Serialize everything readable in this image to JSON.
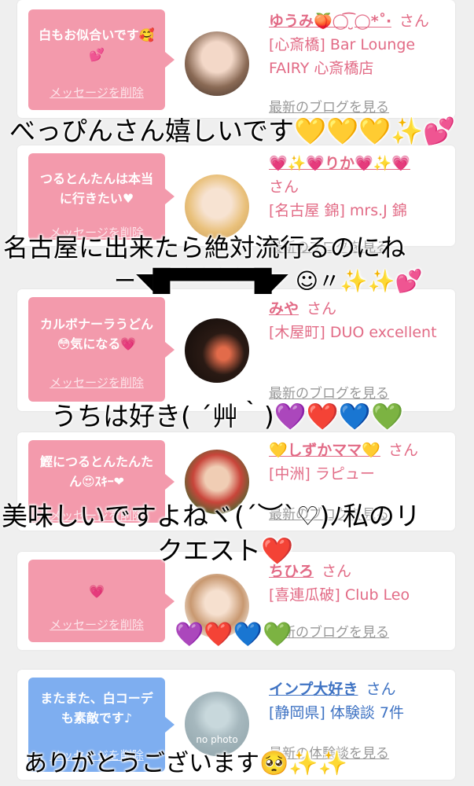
{
  "cards": [
    {
      "message": "白もお似合いです🥰💕",
      "delete_label": "メッセージを削除",
      "user": "ゆうみ🍑◯͡ ̮◯*˚‧",
      "san": "さん",
      "shop_area": "[心斎橋] Bar Lounge FAIRY 心斎橋店",
      "blog_link": "最新のブログを見る"
    },
    {
      "message": "つるとんたんは本当に行きたい♥",
      "delete_label": "メッセージを削除",
      "user": "💗✨💗りか💗✨💗",
      "san": "さん",
      "shop_area": "[名古屋 錦] mrs.J 錦",
      "blog_link": "最新のブログを見る"
    },
    {
      "message": "カルボナーラうどん😳気になる💗",
      "delete_label": "メッセージを削除",
      "user": "みや",
      "san": "さん",
      "shop_area": "[木屋町] DUO excellent",
      "blog_link": "最新のブログを見る"
    },
    {
      "message": "鰹につるとんたんたん😍ｽｷｰ❤",
      "delete_label": "メッセージを削除",
      "user": "💛しずかママ💛",
      "san": "さん",
      "shop_area": "[中洲] ラピュー",
      "blog_link": "最新のブログを見る"
    },
    {
      "message": "💗",
      "delete_label": "メッセージを削除",
      "user": "ちひろ",
      "san": "さん",
      "shop_area": "[喜連瓜破] Club Leo",
      "blog_link": "最新のブログを見る"
    },
    {
      "message": "またまた、白コーデも素敵です♪",
      "delete_label": "メッセージを削除",
      "user": "インプ大好き",
      "san": "さん",
      "shop_area": "[静岡県] 体験談 7件",
      "blog_link": "最新の体験談を見る",
      "avatar_text": "no photo"
    }
  ],
  "overlays": {
    "line1": "べっぴんさん嬉しいです💛💛💛✨💕",
    "line2a": "名古屋に出来たら絶対流行るのにね",
    "line2b": "ー◥█▀▀▀▀▀█◤ ☺︎〃✨✨💕",
    "line3": "うちは好き( ´艸｀)💜❤️💙💚",
    "line4a": "美味しいですよねヾ(´︶`♡)ﾉ私のリ",
    "line4b": "クエスト❤️",
    "hearts": "💜❤️💙💚",
    "line6": "ありがとうございます🥺✨✨"
  },
  "colors": {
    "pink": "#f39aac",
    "blue": "#7eaef0",
    "pink_text": "#e26b86",
    "blue_text": "#3f73c3"
  }
}
